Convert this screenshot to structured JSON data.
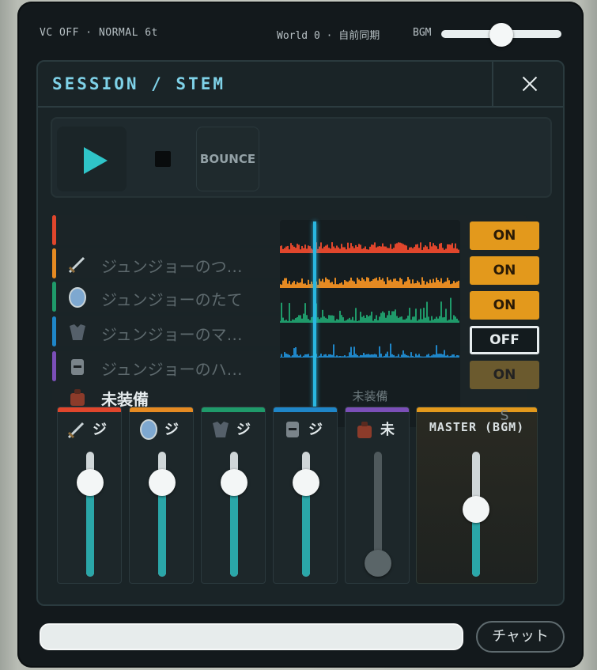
{
  "status": {
    "left": "VC OFF · NORMAL 6t",
    "right": "World 0 · 自前同期",
    "bgm_label": "BGM",
    "bgm_level": 0.5
  },
  "modal": {
    "title": "SESSION / STEM"
  },
  "transport": {
    "bounce_label": "BOUNCE"
  },
  "tracks": [
    {
      "name": "",
      "color": "#e0462c",
      "toggle": "ON"
    },
    {
      "name": "ジュンジョーのつ…",
      "color": "#e58a22",
      "toggle": "ON",
      "icon": "sword-icon"
    },
    {
      "name": "ジュンジョーのたて",
      "color": "#1f9a6a",
      "toggle": "ON",
      "icon": "shield-icon"
    },
    {
      "name": "ジュンジョーのマ…",
      "color": "#1f86c8",
      "toggle": "OFF",
      "icon": "armor-icon"
    },
    {
      "name": "ジュンジョーのハ…",
      "color": "#7b4fb8",
      "toggle": "ON",
      "icon": "helmet-icon"
    },
    {
      "name": "未装備",
      "color": "",
      "toggle": "",
      "icon": "bag-icon"
    }
  ],
  "waveform": {
    "label": "未装備",
    "lane_colors": [
      "#e0462c",
      "#e58a22",
      "#1f9a6a",
      "#1f86c8"
    ]
  },
  "mixer": {
    "channels": [
      {
        "name": "ジ",
        "icon": "sword-icon",
        "color": "#e0462c",
        "level": 0.82,
        "muted": false
      },
      {
        "name": "ジ",
        "icon": "shield-icon",
        "color": "#e58a22",
        "level": 0.82,
        "muted": false
      },
      {
        "name": "ジ",
        "icon": "armor-icon",
        "color": "#1f9a6a",
        "level": 0.82,
        "muted": false
      },
      {
        "name": "ジ",
        "icon": "helmet-icon",
        "color": "#1f86c8",
        "level": 0.82,
        "muted": false
      },
      {
        "name": "未",
        "icon": "bag-icon",
        "color": "#7b4fb8",
        "level": 0.0,
        "muted": true
      }
    ],
    "master_label": "MASTER (BGM)",
    "master_level": 0.55,
    "s_label": "S"
  },
  "chat": {
    "input_value": "",
    "button_label": "チャット"
  },
  "colors": {
    "accent": "#7fd2e8",
    "play": "#2fc4c8",
    "on": "#e3991c",
    "fader": "#2aa6a8",
    "playhead": "#29b6e0"
  }
}
